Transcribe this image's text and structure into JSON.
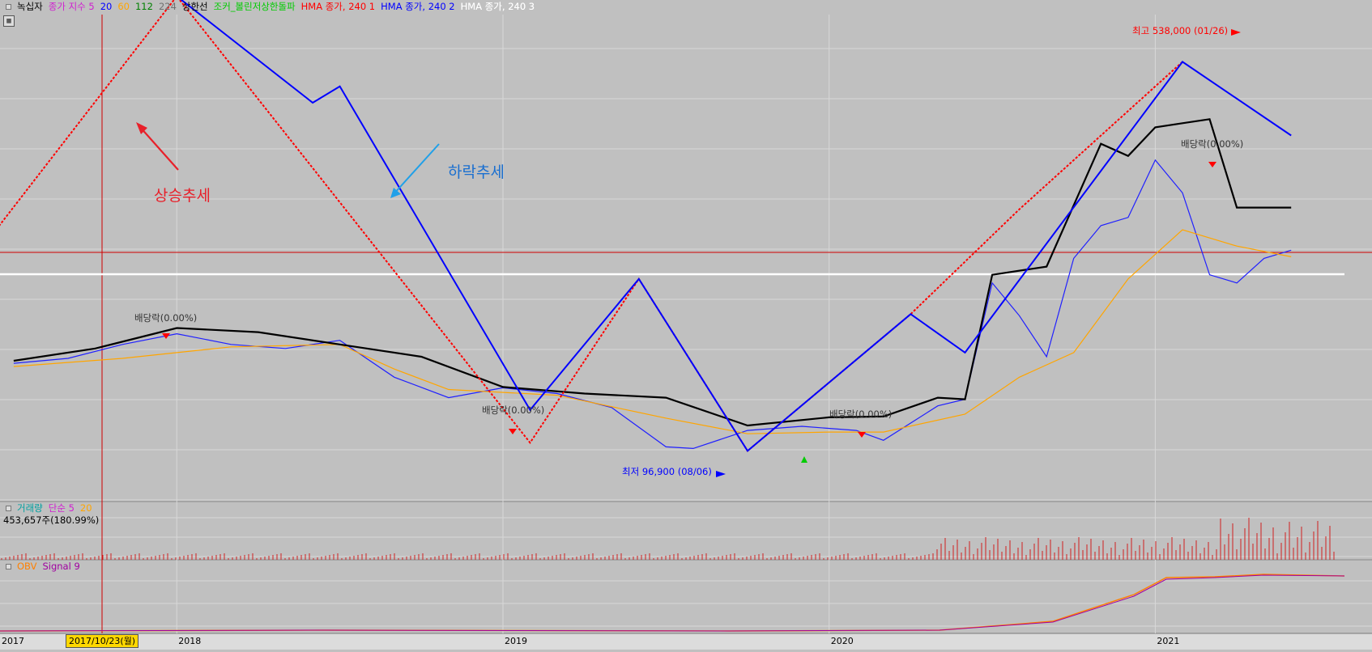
{
  "legend_main": [
    {
      "text": "녹십자",
      "color": "#000000"
    },
    {
      "text": "종가 지수 5",
      "color": "#d020d0"
    },
    {
      "text": "20",
      "color": "#0000ff"
    },
    {
      "text": "60",
      "color": "#ffa500"
    },
    {
      "text": "112",
      "color": "#008000"
    },
    {
      "text": "224",
      "color": "#707070"
    },
    {
      "text": "상한선",
      "color": "#000000"
    },
    {
      "text": "조커_볼린저상한돌파",
      "color": "#00cc00"
    },
    {
      "text": "HMA 종가, 240 1",
      "color": "#ff0000"
    },
    {
      "text": "HMA 종가, 240 2",
      "color": "#0000ff"
    },
    {
      "text": "HMA 종가, 240 3",
      "color": "#ffffff"
    }
  ],
  "legend_volume": [
    {
      "text": "거래량",
      "color": "#00a0a0"
    },
    {
      "text": "단순 5",
      "color": "#d020d0"
    },
    {
      "text": "20",
      "color": "#ffa500"
    }
  ],
  "volume_value": "453,657주(180.99%)",
  "legend_obv": [
    {
      "text": "OBV",
      "color": "#ff8000"
    },
    {
      "text": "Signal 9",
      "color": "#a000a0"
    }
  ],
  "crosshair_date": "2017/10/23(월)",
  "chart_data": {
    "type": "line",
    "title": "녹십자",
    "x_axis_labels": [
      "2017",
      "2018",
      "2019",
      "2020",
      "2021"
    ],
    "series": [
      {
        "name": "종가 지수 5",
        "color": "#2020ff",
        "x": [
          "2017-07",
          "2017-09",
          "2017-11",
          "2018-01",
          "2018-03",
          "2018-05",
          "2018-07",
          "2018-09",
          "2018-11",
          "2019-01",
          "2019-03",
          "2019-05",
          "2019-07",
          "2019-08",
          "2019-10",
          "2019-12",
          "2020-02",
          "2020-03",
          "2020-05",
          "2020-06",
          "2020-07",
          "2020-08",
          "2020-09",
          "2020-10",
          "2020-11",
          "2020-12",
          "2021-01",
          "2021-02",
          "2021-03",
          "2021-04",
          "2021-05",
          "2021-06"
        ],
        "values": [
          202000,
          208000,
          225000,
          238000,
          225000,
          220000,
          230000,
          185000,
          160000,
          172000,
          165000,
          148000,
          100000,
          98000,
          120000,
          125000,
          120000,
          108000,
          150000,
          158000,
          300000,
          260000,
          210000,
          330000,
          370000,
          380000,
          450000,
          410000,
          310000,
          300000,
          330000,
          340000
        ]
      },
      {
        "name": "60",
        "color": "#ffa500",
        "x": [
          "2017-07",
          "2017-11",
          "2018-03",
          "2018-07",
          "2018-09",
          "2018-11",
          "2019-03",
          "2019-07",
          "2019-10",
          "2020-01",
          "2020-03",
          "2020-06",
          "2020-08",
          "2020-10",
          "2020-12",
          "2021-02",
          "2021-04",
          "2021-06"
        ],
        "values": [
          198000,
          208000,
          222000,
          225000,
          195000,
          170000,
          163000,
          135000,
          116000,
          118000,
          118000,
          140000,
          185000,
          215000,
          305000,
          365000,
          345000,
          332000
        ]
      },
      {
        "name": "상한선",
        "color": "#000000",
        "x": [
          "2017-07",
          "2017-10",
          "2018-01",
          "2018-04",
          "2018-07",
          "2018-10",
          "2019-01",
          "2019-04",
          "2019-07",
          "2019-10",
          "2020-01",
          "2020-03",
          "2020-05",
          "2020-06",
          "2020-07",
          "2020-09",
          "2020-11",
          "2020-12",
          "2021-01",
          "2021-02",
          "2021-03",
          "2021-04",
          "2021-06"
        ],
        "values": [
          205000,
          220000,
          245000,
          240000,
          225000,
          210000,
          173000,
          165000,
          160000,
          126000,
          136000,
          137000,
          160000,
          158000,
          310000,
          320000,
          470000,
          455000,
          490000,
          495000,
          500000,
          392000,
          392000
        ]
      },
      {
        "name": "HMA 종가, 240 1",
        "color": "#ff0000",
        "x": [
          "2017-06",
          "2018-01",
          "2019-02",
          "2019-06",
          "2019-10",
          "2020-04",
          "2020-08",
          "2021-02"
        ],
        "values": [
          350000,
          650000,
          105000,
          305000,
          95000,
          262000,
          390000,
          570000
        ]
      },
      {
        "name": "HMA 종가, 240 2",
        "color": "#0000ff",
        "x": [
          "2018-01",
          "2018-06",
          "2018-07",
          "2019-02",
          "2019-06",
          "2019-10",
          "2020-04",
          "2020-06",
          "2021-02",
          "2021-06"
        ],
        "values": [
          650000,
          520000,
          540000,
          145000,
          305000,
          95000,
          262000,
          215000,
          570000,
          480000
        ]
      }
    ],
    "annotations": [
      {
        "text": "상승추세",
        "color": "#e8202a"
      },
      {
        "text": "하락추세",
        "color": "#1a6fd0"
      },
      {
        "text": "최고 538,000 (01/26)",
        "color": "#ff0000"
      },
      {
        "text": "최저 96,900 (08/06)",
        "color": "#0000ff"
      },
      {
        "text": "배당락(0.00%)",
        "color": "#333333"
      },
      {
        "text": "배당락(0.00%)",
        "color": "#333333"
      },
      {
        "text": "배당락(0.00%)",
        "color": "#333333"
      },
      {
        "text": "배당락(0.00%)",
        "color": "#333333"
      }
    ],
    "grid": true
  }
}
